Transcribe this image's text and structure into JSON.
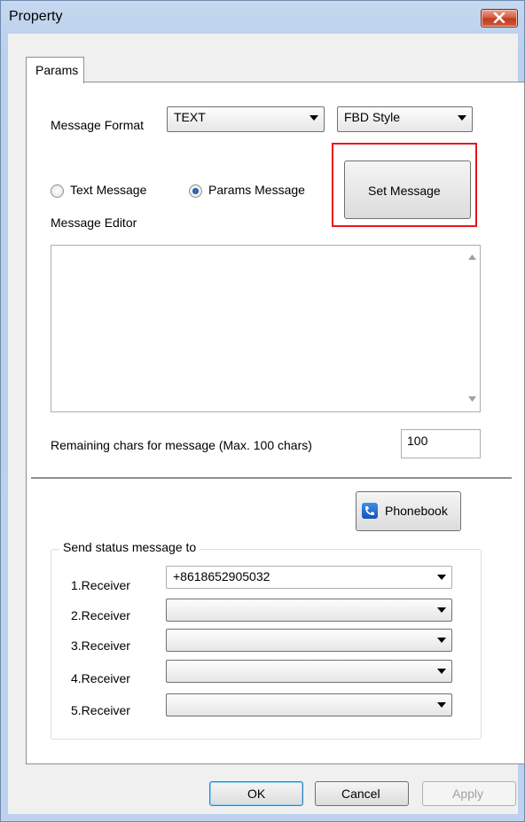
{
  "window": {
    "title": "Property"
  },
  "tabs": [
    {
      "label": "Params"
    }
  ],
  "message_format": {
    "label": "Message Format",
    "format_value": "TEXT",
    "style_value": "FBD Style"
  },
  "message_type": {
    "text_label": "Text Message",
    "params_label": "Params Message",
    "selected": "Params Message"
  },
  "set_message_button": "Set Message",
  "editor": {
    "label": "Message Editor",
    "value": ""
  },
  "remaining": {
    "label": "Remaining chars for message (Max. 100 chars)",
    "value": "100"
  },
  "phonebook_button": "Phonebook",
  "send_status": {
    "legend": "Send status message to",
    "receivers": [
      {
        "label": "1.Receiver",
        "value": "+8618652905032"
      },
      {
        "label": "2.Receiver",
        "value": ""
      },
      {
        "label": "3.Receiver",
        "value": ""
      },
      {
        "label": "4.Receiver",
        "value": ""
      },
      {
        "label": "5.Receiver",
        "value": ""
      }
    ]
  },
  "footer": {
    "ok": "OK",
    "cancel": "Cancel",
    "apply": "Apply"
  },
  "colors": {
    "highlight": "#e8141d",
    "close_button": "#c7432a"
  },
  "icons": {
    "close": "close-icon",
    "phonebook": "phone-icon"
  }
}
